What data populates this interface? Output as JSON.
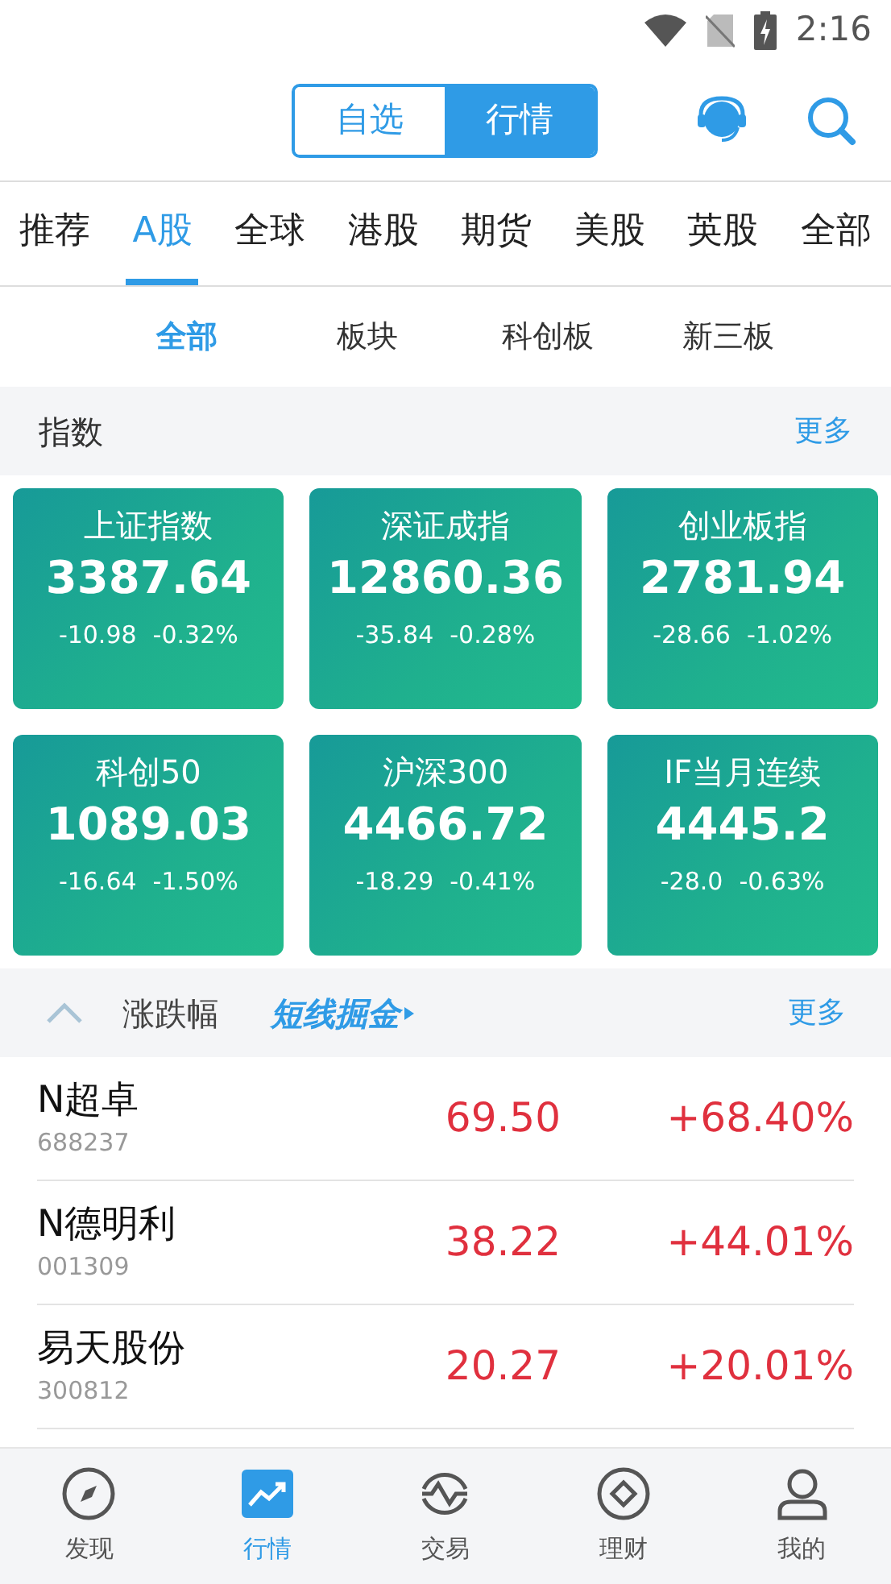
{
  "status_bar": {
    "time": "2:16"
  },
  "header": {
    "segments": [
      {
        "label": "自选",
        "selected": false
      },
      {
        "label": "行情",
        "selected": true
      }
    ]
  },
  "market_tabs": [
    {
      "label": "推荐",
      "selected": false
    },
    {
      "label": "A股",
      "selected": true
    },
    {
      "label": "全球",
      "selected": false
    },
    {
      "label": "港股",
      "selected": false
    },
    {
      "label": "期货",
      "selected": false
    },
    {
      "label": "美股",
      "selected": false
    },
    {
      "label": "英股",
      "selected": false
    },
    {
      "label": "全部",
      "selected": false
    }
  ],
  "sub_tabs": [
    {
      "label": "全部",
      "selected": true
    },
    {
      "label": "板块",
      "selected": false
    },
    {
      "label": "科创板",
      "selected": false
    },
    {
      "label": "新三板",
      "selected": false
    }
  ],
  "index_section": {
    "title": "指数",
    "more": "更多"
  },
  "indices": [
    {
      "name": "上证指数",
      "value": "3387.64",
      "change": "-10.98",
      "percent": "-0.32%"
    },
    {
      "name": "深证成指",
      "value": "12860.36",
      "change": "-35.84",
      "percent": "-0.28%"
    },
    {
      "name": "创业板指",
      "value": "2781.94",
      "change": "-28.66",
      "percent": "-1.02%"
    },
    {
      "name": "科创50",
      "value": "1089.03",
      "change": "-16.64",
      "percent": "-1.50%"
    },
    {
      "name": "沪深300",
      "value": "4466.72",
      "change": "-18.29",
      "percent": "-0.41%"
    },
    {
      "name": "IF当月连续",
      "value": "4445.2",
      "change": "-28.0",
      "percent": "-0.63%"
    }
  ],
  "movers_section": {
    "title": "涨跌幅",
    "expanded": true,
    "promo": "短线掘金",
    "more": "更多"
  },
  "stocks": [
    {
      "name": "N超卓",
      "code": "688237",
      "price": "69.50",
      "percent": "+68.40%"
    },
    {
      "name": "N德明利",
      "code": "001309",
      "price": "38.22",
      "percent": "+44.01%"
    },
    {
      "name": "易天股份",
      "code": "300812",
      "price": "20.27",
      "percent": "+20.01%"
    }
  ],
  "bottom_nav": [
    {
      "label": "发现",
      "kind": "compass",
      "selected": false
    },
    {
      "label": "行情",
      "kind": "chart",
      "selected": true
    },
    {
      "label": "交易",
      "kind": "trade",
      "selected": false
    },
    {
      "label": "理财",
      "kind": "coin",
      "selected": false
    },
    {
      "label": "我的",
      "kind": "person",
      "selected": false
    }
  ]
}
